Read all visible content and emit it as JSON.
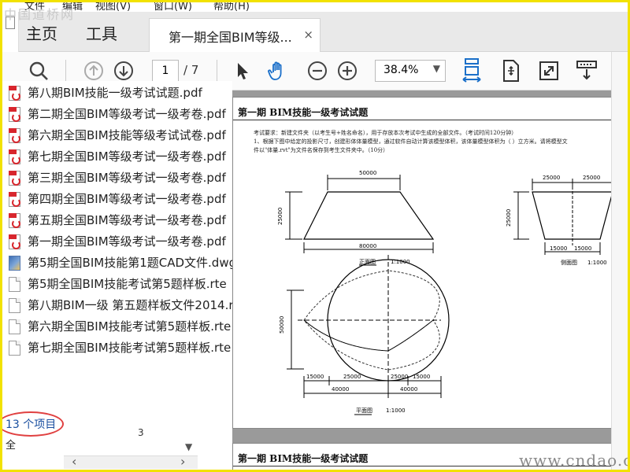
{
  "menubar": {
    "items": [
      "文件",
      "编辑",
      "视图(V)",
      "窗口(W)",
      "帮助(H)"
    ]
  },
  "watermark_top": "中国道桥网",
  "tabs": {
    "home": "主页",
    "tools": "工具",
    "document": "第一期全国BIM等级...",
    "close": "×"
  },
  "left_strip": {
    "label": "题"
  },
  "toolbar": {
    "page_current": "1",
    "page_total": "/ 7",
    "zoom": "38.4%",
    "icons": [
      "search-icon",
      "arrow-up-icon",
      "arrow-down-icon",
      "pointer-icon",
      "hand-icon",
      "zoom-out-icon",
      "zoom-in-icon",
      "fit-width-icon",
      "fit-page-icon",
      "fullscreen-icon",
      "scroll-mode-icon"
    ]
  },
  "files": [
    {
      "name": "第八期BIM技能一级考试试题.pdf",
      "type": "pdf"
    },
    {
      "name": "第二期全国BIM等级考试一级考卷.pdf",
      "type": "pdf"
    },
    {
      "name": "第六期全国BIM技能等级考试试卷.pdf",
      "type": "pdf"
    },
    {
      "name": "第七期全国BIM等级考试一级考卷.pdf",
      "type": "pdf"
    },
    {
      "name": "第三期全国BIM等级考试一级考卷.pdf",
      "type": "pdf"
    },
    {
      "name": "第四期全国BIM等级考试一级考卷.pdf",
      "type": "pdf"
    },
    {
      "name": "第五期全国BIM等级考试一级考卷.pdf",
      "type": "pdf"
    },
    {
      "name": "第一期全国BIM等级考试一级考卷.pdf",
      "type": "pdf"
    },
    {
      "name": "第5期全国BIM技能第1题CAD文件.dwg",
      "type": "dwg"
    },
    {
      "name": "第5期全国BIM技能考试第5题样板.rte",
      "type": "rte"
    },
    {
      "name": "第八期BIM一级 第五题样板文件2014.rte",
      "type": "rte"
    },
    {
      "name": "第六期全国BIM技能考试第5题样板.rte",
      "type": "rte"
    },
    {
      "name": "第七期全国BIM技能考试第5题样板.rte",
      "type": "rte"
    }
  ],
  "status": {
    "count": "13 个项目",
    "line": "全",
    "scroll_num": "3"
  },
  "document": {
    "page_title": "第一期 BIM技能一级考试试题",
    "req_line1": "考试要求：新建文件夹（以考生号+姓名命名），用于存放本次考试中生成的全部文件。（考试时间120分钟）",
    "req_line2": "1、根据下图中给定的投影尺寸，创建形体体量模型，通过软件自动计算该模型体积，该体量模型体积为（        ）立方米。请将模型文",
    "req_line3": "件以\"体量.rvt\"为文件名保存到考生文件夹中。（10分）",
    "front": {
      "top": "50000",
      "height": "25000",
      "bottom": "80000",
      "caption": "正面图",
      "scale": "1:1000"
    },
    "side": {
      "top_left": "25000",
      "top_right": "25000",
      "height": "25000",
      "bottom_left": "15000",
      "bottom_right": "15000",
      "caption": "侧面图",
      "scale": "1:1000"
    },
    "plan": {
      "height": "50000",
      "d1": "15000",
      "d2": "25000",
      "d3": "25000",
      "d4": "15000",
      "t1": "40000",
      "t2": "40000",
      "caption": "平面图",
      "scale": "1:1000"
    },
    "page2_title": "第一期 BIM技能一级考试试题"
  },
  "watermark_br": "www.cndao.com"
}
